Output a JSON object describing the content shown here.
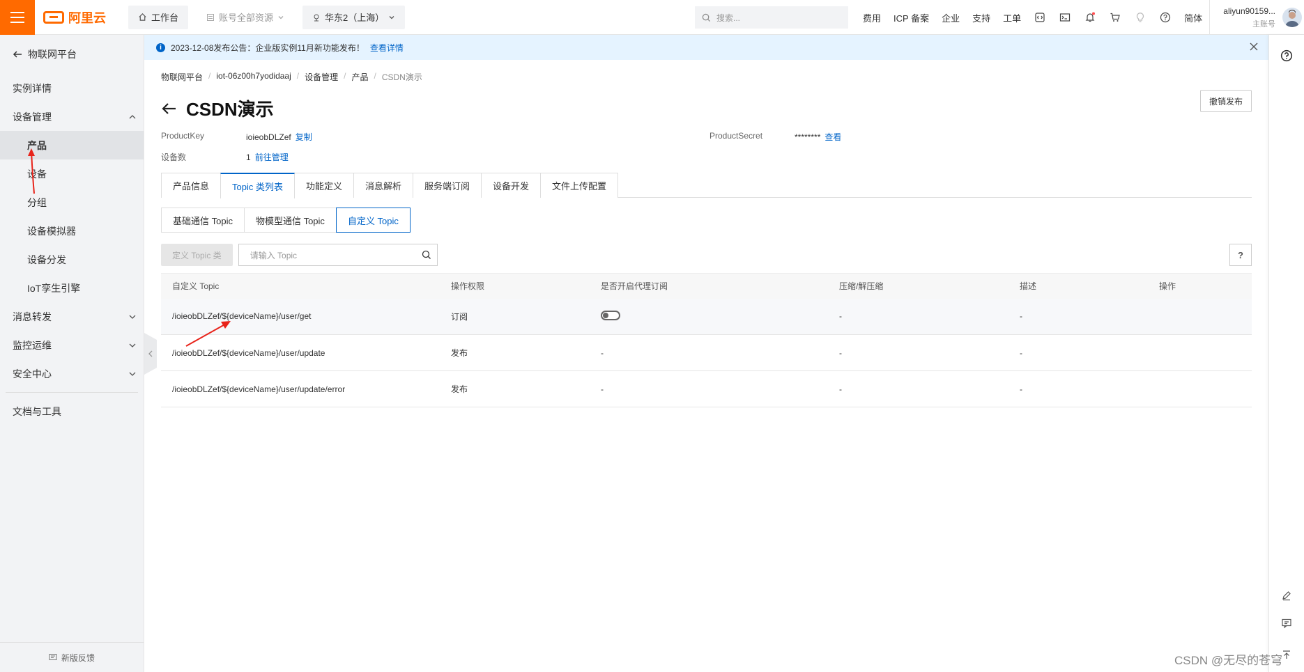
{
  "topbar": {
    "brand": "阿里云",
    "workbench": "工作台",
    "resources": "账号全部资源",
    "region": "华东2（上海）",
    "search_placeholder": "搜索...",
    "links": [
      "费用",
      "ICP 备案",
      "企业",
      "支持",
      "工单"
    ],
    "lang": "简体",
    "username": "aliyun90159...",
    "account_type": "主账号"
  },
  "sidebar": {
    "back_label": "物联网平台",
    "items": [
      {
        "label": "实例详情"
      },
      {
        "label": "设备管理"
      },
      {
        "label": "产品"
      },
      {
        "label": "设备"
      },
      {
        "label": "分组"
      },
      {
        "label": "设备模拟器"
      },
      {
        "label": "设备分发"
      },
      {
        "label": "IoT孪生引擎"
      },
      {
        "label": "消息转发"
      },
      {
        "label": "监控运维"
      },
      {
        "label": "安全中心"
      },
      {
        "label": "文档与工具"
      }
    ],
    "feedback": "新版反馈"
  },
  "notice": {
    "text": "2023-12-08发布公告：企业版实例11月新功能发布！",
    "link": "查看详情"
  },
  "breadcrumb": [
    "物联网平台",
    "iot-06z00h7yodidaaj",
    "设备管理",
    "产品",
    "CSDN演示"
  ],
  "page": {
    "title": "CSDN演示",
    "revoke_button": "撤销发布"
  },
  "meta": {
    "product_key_label": "ProductKey",
    "product_key": "ioieobDLZef",
    "copy": "复制",
    "product_secret_label": "ProductSecret",
    "product_secret": "********",
    "view": "查看",
    "device_count_label": "设备数",
    "device_count": "1",
    "manage": "前往管理"
  },
  "tabs": [
    "产品信息",
    "Topic 类列表",
    "功能定义",
    "消息解析",
    "服务端订阅",
    "设备开发",
    "文件上传配置"
  ],
  "subtabs": [
    "基础通信 Topic",
    "物模型通信 Topic",
    "自定义 Topic"
  ],
  "toolbar": {
    "define_button": "定义 Topic 类",
    "search_placeholder": "请输入 Topic",
    "help": "?"
  },
  "table": {
    "headers": [
      "自定义 Topic",
      "操作权限",
      "是否开启代理订阅",
      "压缩/解压缩",
      "描述",
      "操作"
    ],
    "rows": [
      {
        "topic": "/ioieobDLZef/${deviceName}/user/get",
        "perm": "订阅",
        "proxy": "",
        "compress": "-",
        "desc": "-"
      },
      {
        "topic": "/ioieobDLZef/${deviceName}/user/update",
        "perm": "发布",
        "proxy": "-",
        "compress": "-",
        "desc": "-"
      },
      {
        "topic": "/ioieobDLZef/${deviceName}/user/update/error",
        "perm": "发布",
        "proxy": "-",
        "compress": "-",
        "desc": "-"
      }
    ]
  },
  "watermark": "CSDN @无尽的苍穹",
  "colors": {
    "brand": "#ff6a00",
    "link": "#0064c8",
    "annotation": "#e8231a"
  }
}
